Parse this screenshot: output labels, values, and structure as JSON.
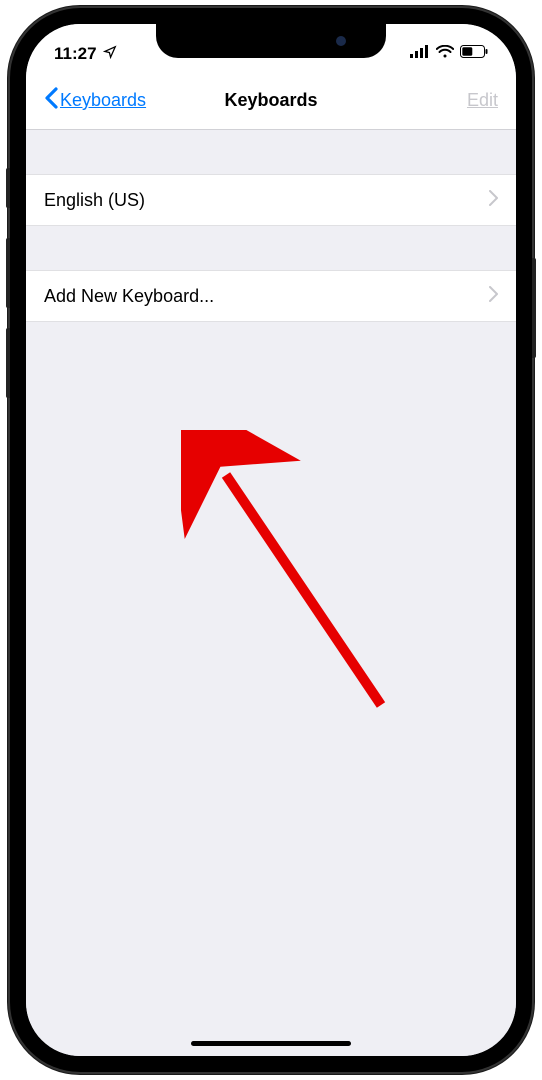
{
  "status_bar": {
    "time": "11:27"
  },
  "nav": {
    "back_label": "Keyboards",
    "title": "Keyboards",
    "edit_label": "Edit"
  },
  "rows": {
    "keyboard0": "English (US)",
    "add": "Add New Keyboard..."
  }
}
